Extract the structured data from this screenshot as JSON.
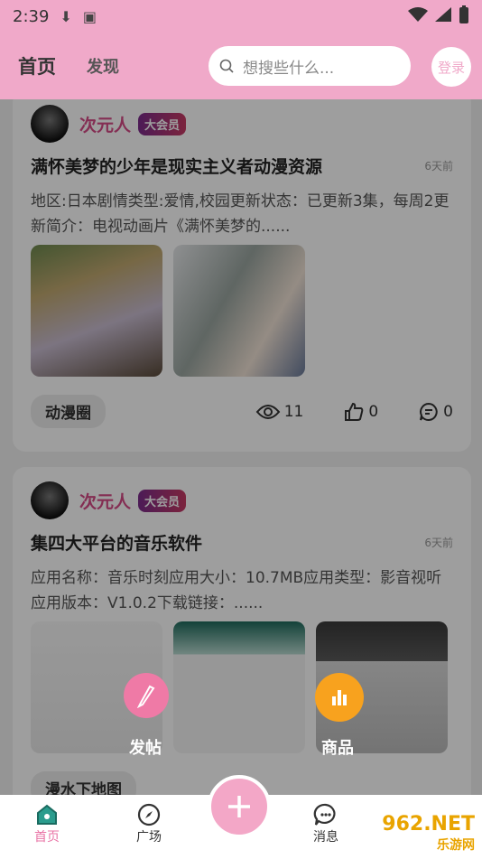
{
  "status_bar": {
    "time": "2:39"
  },
  "header": {
    "tab_home": "首页",
    "tab_discover": "发现",
    "search_placeholder": "想搜些什么...",
    "login": "登录"
  },
  "posts": [
    {
      "username": "次元人",
      "badge": "大会员",
      "title": "满怀美梦的少年是现实主义者动漫资源",
      "time_ago": "6天前",
      "description": "地区:日本剧情类型:爱情,校园更新状态：已更新3集，每周2更新简介：电视动画片《满怀美梦的......",
      "tag": "动漫圈",
      "views": "11",
      "likes": "0",
      "comments": "0"
    },
    {
      "username": "次元人",
      "badge": "大会员",
      "title": "集四大平台的音乐软件",
      "time_ago": "6天前",
      "description": "应用名称：音乐时刻应用大小：10.7MB应用类型：影音视听应用版本：V1.0.2下载链接：......",
      "tag": "漫水下地图"
    }
  ],
  "floating_actions": {
    "post_label": "发帖",
    "goods_label": "商品"
  },
  "bottom_nav": {
    "home": "首页",
    "square": "广场",
    "messages": "消息"
  },
  "watermark": {
    "brand": "962.NET",
    "subtitle": "乐游网"
  },
  "colors": {
    "brand_pink": "#f0a9c9",
    "accent_pink": "#e973a5",
    "orange": "#f8a21e"
  }
}
